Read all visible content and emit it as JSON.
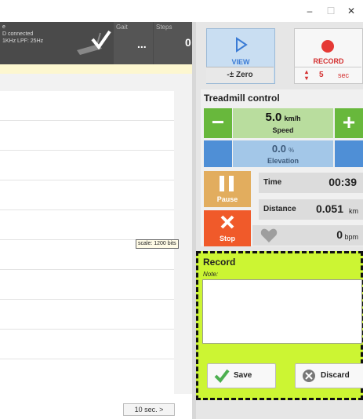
{
  "window": {
    "minimize": "–",
    "maximize": "☐",
    "close": "✕"
  },
  "device": {
    "line1": "e",
    "line2": "D connected",
    "line3": "1KHz   LPF: 25Hz",
    "gait_label": "Gait",
    "gait_value": "...",
    "steps_label": "Steps",
    "steps_value": "0"
  },
  "chart": {
    "scale_label": "scale: 1200 bits",
    "time_window": "10 sec.  >"
  },
  "controls": {
    "view_label": "VIEW",
    "zero_label": "-± Zero",
    "record_label": "RECORD",
    "record_seconds": "5",
    "record_unit": "sec"
  },
  "treadmill": {
    "title": "Treadmill control",
    "speed_value": "5.0",
    "speed_unit": "km/h",
    "speed_label": "Speed",
    "elevation_value": "0.0",
    "elevation_unit": "%",
    "elevation_label": "Elevation",
    "pause_label": "Pause",
    "stop_label": "Stop",
    "time_label": "Time",
    "time_value": "00:39",
    "distance_label": "Distance",
    "distance_value": "0.051",
    "distance_unit": "km",
    "hr_value": "0",
    "hr_unit": "bpm"
  },
  "record": {
    "title": "Record",
    "note_label": "Note:",
    "note_value": "",
    "save_label": "Save",
    "discard_label": "Discard"
  },
  "colors": {
    "green": "#68b83c",
    "blue": "#4f8fd6",
    "orange": "#e2ad5e",
    "red": "#f05a2a",
    "record_bg": "#ccf533"
  }
}
